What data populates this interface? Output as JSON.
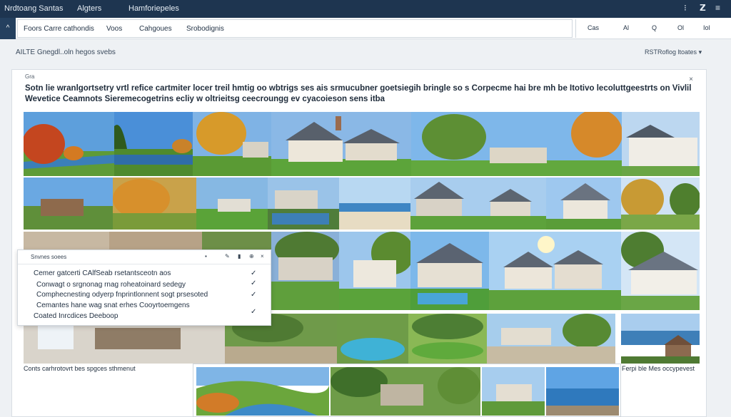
{
  "topbar": {
    "nav": [
      "Nrdtoang Santas",
      "Algters",
      "Hamforiepeles"
    ],
    "icons": [
      "grid-icon",
      "bold-icon",
      "menu-icon"
    ]
  },
  "filter": {
    "menu_glyph": "^",
    "chips": [
      "Foors Carre cathondis",
      "Voos",
      "Cahgoues",
      "Srobodignis"
    ],
    "tools": [
      "Cas",
      "Al",
      "Q",
      "Ol",
      "Iol"
    ]
  },
  "subheader": {
    "left": "AILTE  Gnegdl..oln hegos svebs",
    "right": "RSTRoflog ltoates"
  },
  "card": {
    "tag": "Gra",
    "close": "×",
    "headline": "Sotn lie wranlgortsetry vrtl refice cartmiter locer treil hmtig oo wbtrigs ses ais srmucubner goetsiegih bringle so s Corpecme hai bre mh be Itotivo lecoluttgeestrts on Vivlil Wevetice Ceamnots Sieremecogetrins ecliy w oltrieitsg ceecroungg ev cyacoieson sens itba"
  },
  "popup": {
    "title": "Snvnes soees",
    "tools": [
      "▪",
      "✎",
      "▮",
      "⊕",
      "×"
    ],
    "rows": [
      {
        "text": "Cemer gatcerti CAlfSeab rsetantsceotn aos",
        "check": "✓"
      },
      {
        "text": "Conwagt o srgnonag rnag roheatoinard sedegy",
        "check": "✓"
      },
      {
        "text": "Comphecnesting odyerp fnprintlonnent sogt prsesoted",
        "check": "✓"
      },
      {
        "text": "Cemantes hane wag snat erhes Cooyrtoemgens",
        "check": ""
      },
      {
        "text": "Coated Inrcdices Deeboop",
        "check": "✓"
      }
    ]
  },
  "captions": {
    "left": "Conts carhrotovrt bes spgces sthmenut",
    "right": "Ferpi ble Mes occypevest"
  },
  "colors": {
    "topbar": "#1e3550",
    "accent": "#24405f",
    "background": "#eef1f4",
    "sky": "#6fa8dc",
    "grass": "#5f9e3a",
    "autumn": "#d9822b"
  }
}
